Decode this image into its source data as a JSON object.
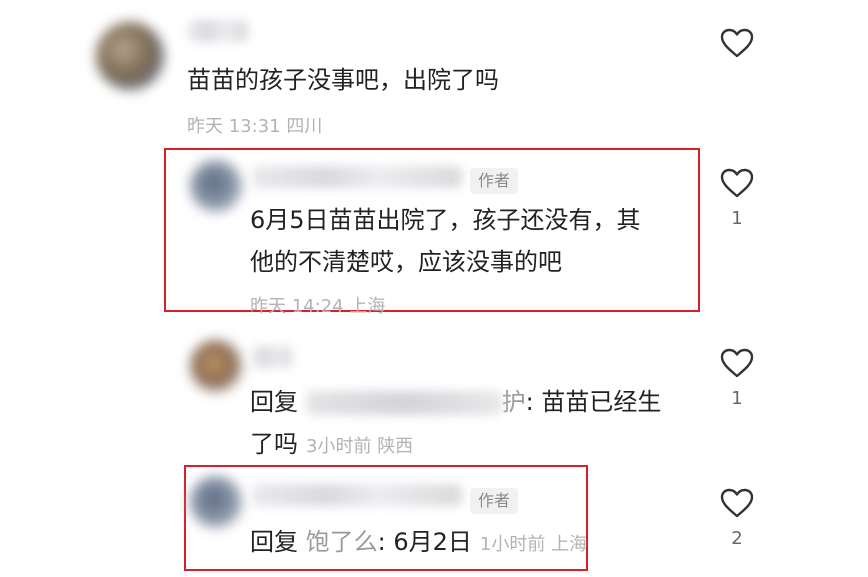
{
  "comments": [
    {
      "text": "苗苗的孩子没事吧，出院了吗",
      "time": "昨天 13:31",
      "location": "四川",
      "likes": ""
    },
    {
      "tag": "作者",
      "text_line1": "6月5日苗苗出院了，孩子还没有，其",
      "text_line2": "他的不清楚哎，应该没事的吧",
      "time": "昨天 14:24",
      "location": "上海",
      "likes": "1"
    },
    {
      "reply_prefix": "回复",
      "reply_target_suffix": "护",
      "text_line1_rest": ": 苗苗已经生",
      "text_line2": "了吗",
      "time": "3小时前",
      "location": "陕西",
      "likes": "1"
    },
    {
      "tag": "作者",
      "reply_prefix": "回复",
      "reply_target": "饱了么",
      "text": ": 6月2日",
      "time": "1小时前",
      "location": "上海",
      "likes": "2"
    }
  ],
  "colors": {
    "highlight_border": "#d8202a",
    "meta_text": "#b3b3b3"
  },
  "icons": {
    "like": "heart-outline-icon"
  }
}
